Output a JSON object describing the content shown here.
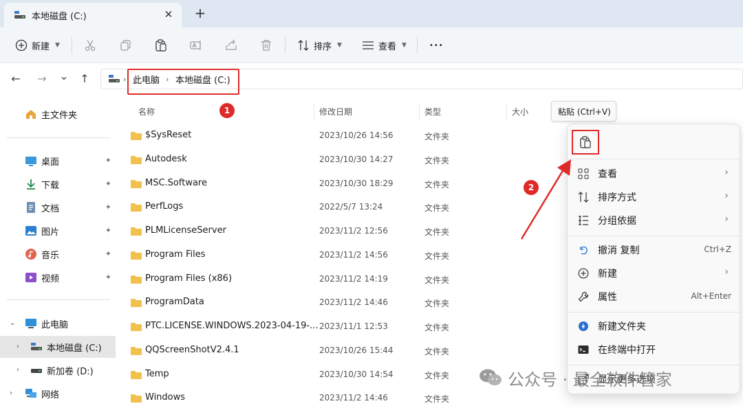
{
  "window": {
    "tab_title": "本地磁盘 (C:)",
    "close_glyph": "✕",
    "new_tab_glyph": "+"
  },
  "toolbar": {
    "new_label": "新建",
    "sort_label": "排序",
    "view_label": "查看",
    "more_glyph": "•••"
  },
  "nav": {
    "back": "←",
    "forward": "→",
    "recent": "⌄",
    "up": "↑"
  },
  "breadcrumb": {
    "items": [
      "此电脑",
      "本地磁盘 (C:)"
    ],
    "sep": "›"
  },
  "sidebar": {
    "home": "主文件夹",
    "quick": [
      {
        "label": "桌面",
        "icon": "desktop-icon"
      },
      {
        "label": "下载",
        "icon": "download-icon"
      },
      {
        "label": "文档",
        "icon": "document-icon"
      },
      {
        "label": "图片",
        "icon": "picture-icon"
      },
      {
        "label": "音乐",
        "icon": "music-icon"
      },
      {
        "label": "视频",
        "icon": "video-icon"
      }
    ],
    "this_pc": "此电脑",
    "drives": [
      {
        "label": "本地磁盘 (C:)",
        "selected": true
      },
      {
        "label": "新加卷 (D:)",
        "selected": false
      }
    ],
    "network": "网络",
    "pin_glyph": "📌"
  },
  "columns": {
    "name": "名称",
    "modified": "修改日期",
    "type": "类型",
    "size": "大小"
  },
  "files": [
    {
      "name": "$SysReset",
      "modified": "2023/10/26 14:56",
      "type": "文件夹"
    },
    {
      "name": "Autodesk",
      "modified": "2023/10/30 14:27",
      "type": "文件夹"
    },
    {
      "name": "MSC.Software",
      "modified": "2023/10/30 18:29",
      "type": "文件夹"
    },
    {
      "name": "PerfLogs",
      "modified": "2022/5/7 13:24",
      "type": "文件夹"
    },
    {
      "name": "PLMLicenseServer",
      "modified": "2023/11/2 12:56",
      "type": "文件夹"
    },
    {
      "name": "Program Files",
      "modified": "2023/11/2 14:56",
      "type": "文件夹"
    },
    {
      "name": "Program Files (x86)",
      "modified": "2023/11/2 14:19",
      "type": "文件夹"
    },
    {
      "name": "ProgramData",
      "modified": "2023/11/2 14:46",
      "type": "文件夹"
    },
    {
      "name": "PTC.LICENSE.WINDOWS.2023-04-19-...",
      "modified": "2023/11/1 12:53",
      "type": "文件夹"
    },
    {
      "name": "QQScreenShotV2.4.1",
      "modified": "2023/10/26 15:44",
      "type": "文件夹"
    },
    {
      "name": "Temp",
      "modified": "2023/10/30 14:54",
      "type": "文件夹"
    },
    {
      "name": "Windows",
      "modified": "2023/11/2 14:46",
      "type": "文件夹"
    }
  ],
  "tooltip": {
    "text": "粘贴 (Ctrl+V)"
  },
  "context_menu": {
    "view": "查看",
    "sort_by": "排序方式",
    "group_by": "分组依据",
    "undo_copy": "撤消 复制",
    "undo_shortcut": "Ctrl+Z",
    "new": "新建",
    "properties": "属性",
    "properties_shortcut": "Alt+Enter",
    "new_folder": "新建文件夹",
    "open_terminal": "在终端中打开",
    "more_options": "显示更多选项",
    "arrow_glyph": "›"
  },
  "annotations": {
    "step1": "1",
    "step2": "2",
    "watermark": "公众号 · 最全软件管家",
    "accent_color": "#e02a2a"
  }
}
